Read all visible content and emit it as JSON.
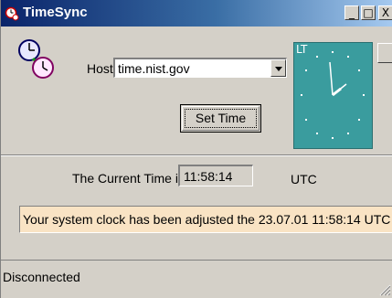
{
  "window": {
    "title": "TimeSync"
  },
  "titlebar_buttons": {
    "minimize": "_",
    "maximize": "□",
    "close": "X"
  },
  "host": {
    "label": "Host:",
    "value": "time.nist.gov"
  },
  "set_time_button": {
    "label": "Set Time"
  },
  "analog_clock": {
    "mode_label": "LT",
    "hour_hand_time": "11:58"
  },
  "current_time": {
    "label": "The Current Time is :",
    "value": "11:58:14",
    "unit": "UTC"
  },
  "message": {
    "text": "Your system clock has been adjusted the 23.07.01 11:58:14 UTC"
  },
  "status_bar": {
    "text": "Disconnected"
  },
  "colors": {
    "clock_face": "#3a9c9e",
    "message_bg": "#f9e3c4",
    "title_bar_start": "#0a246a",
    "title_bar_end": "#a6caf0"
  },
  "icons": [
    "app-clock-icon",
    "clock-sync-icon",
    "dropdown-arrow-icon",
    "resize-grip-icon"
  ]
}
